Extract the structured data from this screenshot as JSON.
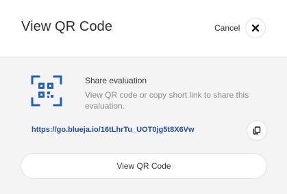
{
  "header": {
    "title": "View QR Code",
    "cancel_label": "Cancel",
    "close_icon": "close-icon"
  },
  "share": {
    "icon": "qr-code-icon",
    "title": "Share evaluation",
    "description": "View QR code or copy short link to share this evaluation.",
    "link": "https://go.blueja.io/16tLhrTu_UOT0jg5t8X6Vw",
    "copy_icon": "copy-icon"
  },
  "actions": {
    "view_qr_label": "View QR Code"
  },
  "colors": {
    "accent": "#1f5fbf",
    "link": "#1f4fa0",
    "background": "#f4f4f4"
  }
}
